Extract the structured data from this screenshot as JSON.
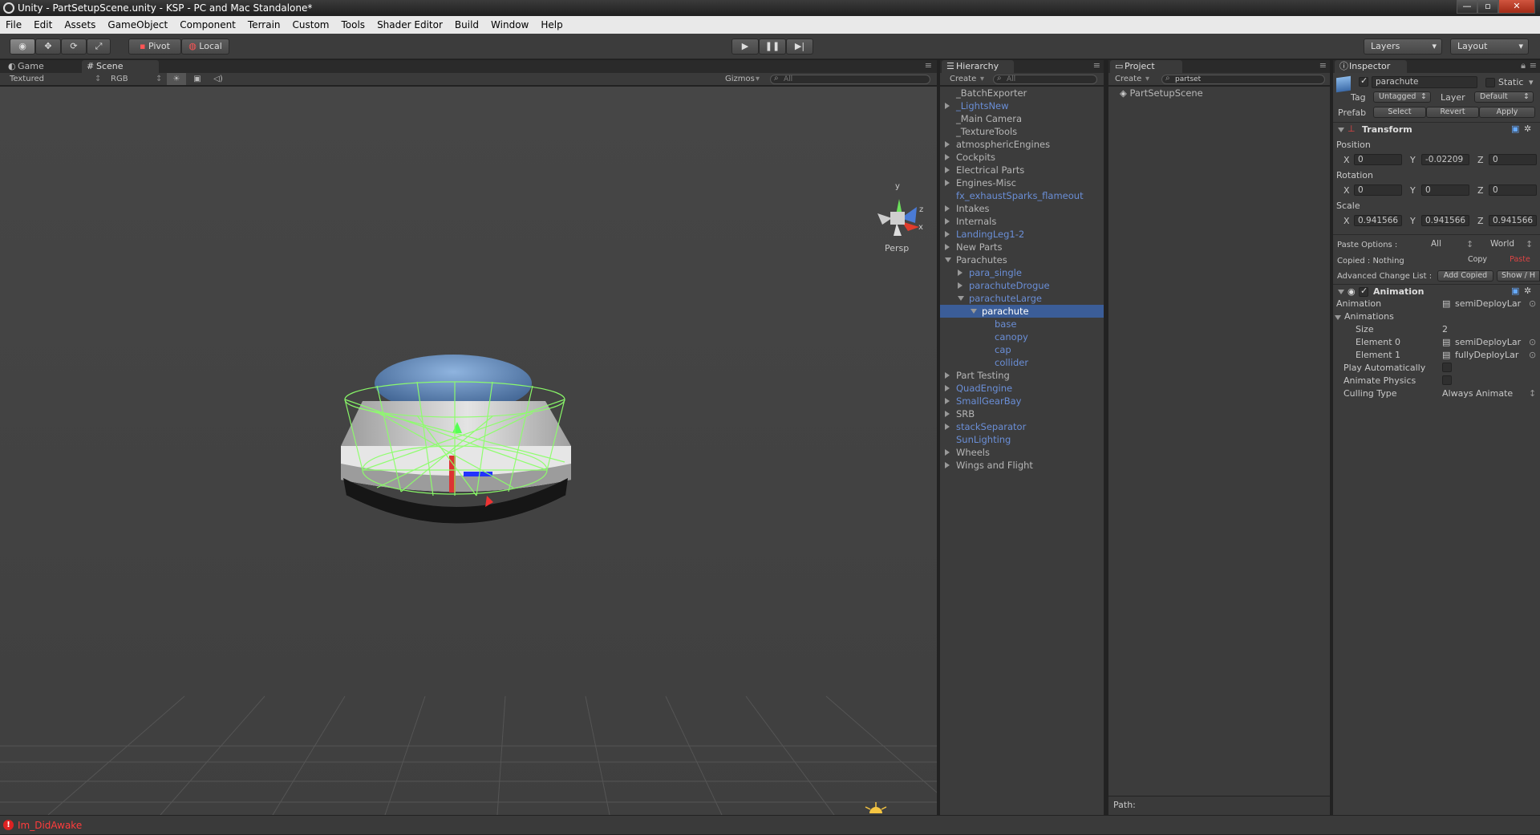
{
  "window": {
    "title": "Unity - PartSetupScene.unity - KSP - PC and Mac Standalone*",
    "min": "—",
    "max": "▫",
    "close": "✕"
  },
  "menu": [
    "File",
    "Edit",
    "Assets",
    "GameObject",
    "Component",
    "Terrain",
    "Custom",
    "Tools",
    "Shader Editor",
    "Build",
    "Window",
    "Help"
  ],
  "toolbar": {
    "pivot": "Pivot",
    "local": "Local",
    "layers": "Layers",
    "layout": "Layout"
  },
  "scene_panel": {
    "tab_game": "Game",
    "tab_scene": "Scene",
    "render_mode": "Textured",
    "color_mode": "RGB",
    "gizmos": "Gizmos",
    "search_placeholder": "All",
    "axis_y": "y",
    "axis_z": "z",
    "axis_x": "x",
    "projection": "Persp"
  },
  "hierarchy": {
    "tab": "Hierarchy",
    "create": "Create",
    "search_placeholder": "All",
    "items": [
      {
        "label": "_BatchExporter",
        "indent": 0,
        "arrow": "none",
        "prefab": false,
        "selected": false
      },
      {
        "label": "_LightsNew",
        "indent": 0,
        "arrow": "right",
        "prefab": true,
        "selected": false
      },
      {
        "label": "_Main Camera",
        "indent": 0,
        "arrow": "none",
        "prefab": false,
        "selected": false
      },
      {
        "label": "_TextureTools",
        "indent": 0,
        "arrow": "none",
        "prefab": false,
        "selected": false
      },
      {
        "label": "atmosphericEngines",
        "indent": 0,
        "arrow": "right",
        "prefab": false,
        "selected": false
      },
      {
        "label": "Cockpits",
        "indent": 0,
        "arrow": "right",
        "prefab": false,
        "selected": false
      },
      {
        "label": "Electrical Parts",
        "indent": 0,
        "arrow": "right",
        "prefab": false,
        "selected": false
      },
      {
        "label": "Engines-Misc",
        "indent": 0,
        "arrow": "right",
        "prefab": false,
        "selected": false
      },
      {
        "label": "fx_exhaustSparks_flameout",
        "indent": 0,
        "arrow": "none",
        "prefab": true,
        "selected": false
      },
      {
        "label": "Intakes",
        "indent": 0,
        "arrow": "right",
        "prefab": false,
        "selected": false
      },
      {
        "label": "Internals",
        "indent": 0,
        "arrow": "right",
        "prefab": false,
        "selected": false
      },
      {
        "label": "LandingLeg1-2",
        "indent": 0,
        "arrow": "right",
        "prefab": true,
        "selected": false
      },
      {
        "label": "New Parts",
        "indent": 0,
        "arrow": "right",
        "prefab": false,
        "selected": false
      },
      {
        "label": "Parachutes",
        "indent": 0,
        "arrow": "down",
        "prefab": false,
        "selected": false
      },
      {
        "label": "para_single",
        "indent": 1,
        "arrow": "right",
        "prefab": true,
        "selected": false
      },
      {
        "label": "parachuteDrogue",
        "indent": 1,
        "arrow": "right",
        "prefab": true,
        "selected": false
      },
      {
        "label": "parachuteLarge",
        "indent": 1,
        "arrow": "down",
        "prefab": true,
        "selected": false
      },
      {
        "label": "parachute",
        "indent": 2,
        "arrow": "down",
        "prefab": true,
        "selected": true
      },
      {
        "label": "base",
        "indent": 3,
        "arrow": "none",
        "prefab": true,
        "selected": false
      },
      {
        "label": "canopy",
        "indent": 3,
        "arrow": "none",
        "prefab": true,
        "selected": false
      },
      {
        "label": "cap",
        "indent": 3,
        "arrow": "none",
        "prefab": true,
        "selected": false
      },
      {
        "label": "collider",
        "indent": 3,
        "arrow": "none",
        "prefab": true,
        "selected": false
      },
      {
        "label": "Part Testing",
        "indent": 0,
        "arrow": "right",
        "prefab": false,
        "selected": false
      },
      {
        "label": "QuadEngine",
        "indent": 0,
        "arrow": "right",
        "prefab": true,
        "selected": false
      },
      {
        "label": "SmallGearBay",
        "indent": 0,
        "arrow": "right",
        "prefab": true,
        "selected": false
      },
      {
        "label": "SRB",
        "indent": 0,
        "arrow": "right",
        "prefab": false,
        "selected": false
      },
      {
        "label": "stackSeparator",
        "indent": 0,
        "arrow": "right",
        "prefab": true,
        "selected": false
      },
      {
        "label": "SunLighting",
        "indent": 0,
        "arrow": "none",
        "prefab": true,
        "selected": false
      },
      {
        "label": "Wheels",
        "indent": 0,
        "arrow": "right",
        "prefab": false,
        "selected": false
      },
      {
        "label": "Wings and Flight",
        "indent": 0,
        "arrow": "right",
        "prefab": false,
        "selected": false
      }
    ]
  },
  "project": {
    "tab": "Project",
    "create": "Create",
    "search_value": "partset",
    "result": "PartSetupScene",
    "path_label": "Path:"
  },
  "inspector": {
    "tab": "Inspector",
    "object_name": "parachute",
    "static": "Static",
    "tag_label": "Tag",
    "tag_value": "Untagged",
    "layer_label": "Layer",
    "layer_value": "Default",
    "prefab_label": "Prefab",
    "select": "Select",
    "revert": "Revert",
    "apply": "Apply",
    "transform": {
      "title": "Transform",
      "position_label": "Position",
      "position": {
        "x": "0",
        "y": "-0.02209",
        "z": "0"
      },
      "rotation_label": "Rotation",
      "rotation": {
        "x": "0",
        "y": "0",
        "z": "0"
      },
      "scale_label": "Scale",
      "scale": {
        "x": "0.941566",
        "y": "0.941566",
        "z": "0.941566"
      }
    },
    "axis": {
      "x": "X",
      "y": "Y",
      "z": "Z"
    },
    "paste_options_label": "Paste Options :",
    "paste_all": "All",
    "paste_world": "World",
    "copied_label": "Copied : Nothing",
    "copy": "Copy",
    "paste": "Paste",
    "adv_label": "Advanced Change List :",
    "add_copied": "Add Copied",
    "show_hide": "Show / H",
    "animation": {
      "title": "Animation",
      "animation_label": "Animation",
      "animation_value": "semiDeployLar",
      "animations_label": "Animations",
      "size_label": "Size",
      "size_value": "2",
      "element0_label": "Element 0",
      "element0_value": "semiDeployLar",
      "element1_label": "Element 1",
      "element1_value": "fullyDeployLar",
      "play_auto_label": "Play Automatically",
      "animate_physics_label": "Animate Physics",
      "culling_label": "Culling Type",
      "culling_value": "Always Animate"
    }
  },
  "status": {
    "message": "Im_DidAwake"
  },
  "colors": {
    "selection": "#3b5d98",
    "prefab_text": "#6a8ed6",
    "error": "#ff3c3c",
    "collider_wire": "#8cff6a"
  }
}
